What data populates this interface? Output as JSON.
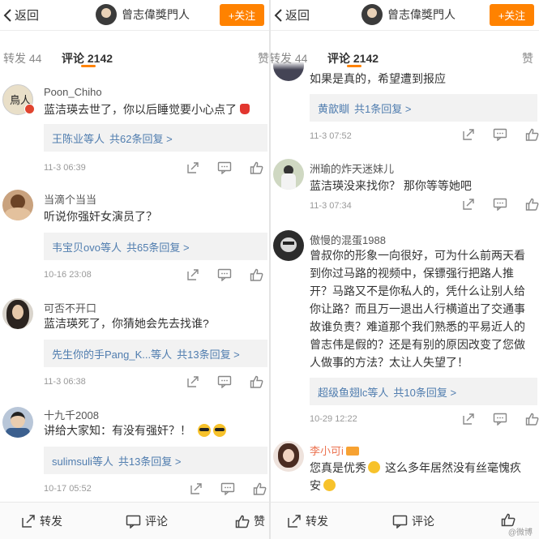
{
  "nav": {
    "back_label": "返回",
    "author_name": "曾志偉獎門人",
    "follow_label": "+关注"
  },
  "tabs": {
    "repost": "转发 44",
    "comments": "评论 2142",
    "likes": "赞"
  },
  "left_comments": [
    {
      "name": "Poon_Chiho",
      "text": "蓝洁瑛去世了，你以后睡觉要小心点了",
      "replies_users": "王陈业等人",
      "replies_count": "共62条回复 >",
      "time": "11-3 06:39"
    },
    {
      "name": "当滴个当当",
      "text": "听说你强奸女演员了？",
      "replies_users": "韦宝贝ovo等人",
      "replies_count": "共65条回复 >",
      "time": "10-16 23:08"
    },
    {
      "name": "可否不开口",
      "text": "蓝洁瑛死了，你猜她会先去找谁?",
      "replies_users": "先生你的手Pang_K...等人",
      "replies_count": "共13条回复 >",
      "time": "11-3 06:38"
    },
    {
      "name": "十九千2008",
      "text": "讲给大家知：有没有强奸？！",
      "replies_users": "sulimsuli等人",
      "replies_count": "共13条回复 >",
      "time": "10-17 05:52"
    }
  ],
  "right_comments": [
    {
      "text": "如果是真的，希望遭到报应",
      "replies_users": "黄歆瞓",
      "replies_count": "共1条回复 >",
      "time": "11-3 07:52"
    },
    {
      "name": "洲瑜的炸天迷妹儿",
      "text": "蓝洁瑛没来找你？ 那你等等她吧",
      "time": "11-3 07:34"
    },
    {
      "name": "傲慢的混蛋1988",
      "text_lines": [
        "曾叔你的形象一向很好，可为什么前两天看",
        "到你过马路的视频中，保镖强行把路人推",
        "开？马路又不是你私人的，凭什么让别人给",
        "你让路？而且万一退出人行横道出了交通事",
        "故谁负责？难道那个我们熟悉的平易近人的",
        "曾志伟是假的？还是有别的原因改变了您做",
        "人做事的方法？太让人失望了！"
      ],
      "replies_users": "超级鱼翅lc等人",
      "replies_count": "共10条回复 >",
      "time": "10-29 12:22"
    },
    {
      "name": "李小可i",
      "text_lines": [
        "您真是优秀",
        "这么多年居然没有丝毫愧疚",
        "安"
      ]
    }
  ],
  "bottom": {
    "repost": "转发",
    "comment": "评论",
    "like": "赞"
  },
  "watermark": "@微博",
  "colors": {
    "accent": "#ff8200",
    "link": "#507daf",
    "reply_bg": "#f2f2f2"
  }
}
